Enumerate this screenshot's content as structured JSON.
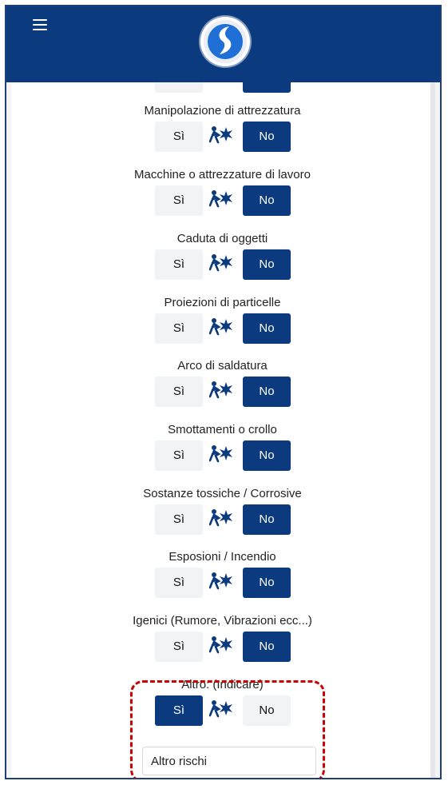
{
  "header": {
    "menu_icon": "hamburger-icon",
    "logo_icon": "app-logo-icon",
    "brand_color": "#0b3b7e"
  },
  "buttons": {
    "yes_label": "Sì",
    "no_label": "No"
  },
  "risk_icon": "hazard-icon",
  "items": [
    {
      "label": "Manipolazione di attrezzatura",
      "selected": "No"
    },
    {
      "label": "Macchine o attrezzature di lavoro",
      "selected": "No"
    },
    {
      "label": "Caduta di oggetti",
      "selected": "No"
    },
    {
      "label": "Proiezioni di particelle",
      "selected": "No"
    },
    {
      "label": "Arco di saldatura",
      "selected": "No"
    },
    {
      "label": "Smottamenti o crollo",
      "selected": "No"
    },
    {
      "label": "Sostanze tossiche / Corrosive",
      "selected": "No"
    },
    {
      "label": "Esposioni / Incendio",
      "selected": "No"
    },
    {
      "label": "Igenici (Rumore, Vibrazioni ecc...)",
      "selected": "No"
    },
    {
      "label": "Altro: (Indicare)",
      "selected": "Sì"
    }
  ],
  "other_input": {
    "value": "Altro rischi"
  },
  "highlight_color": "#cc0000"
}
